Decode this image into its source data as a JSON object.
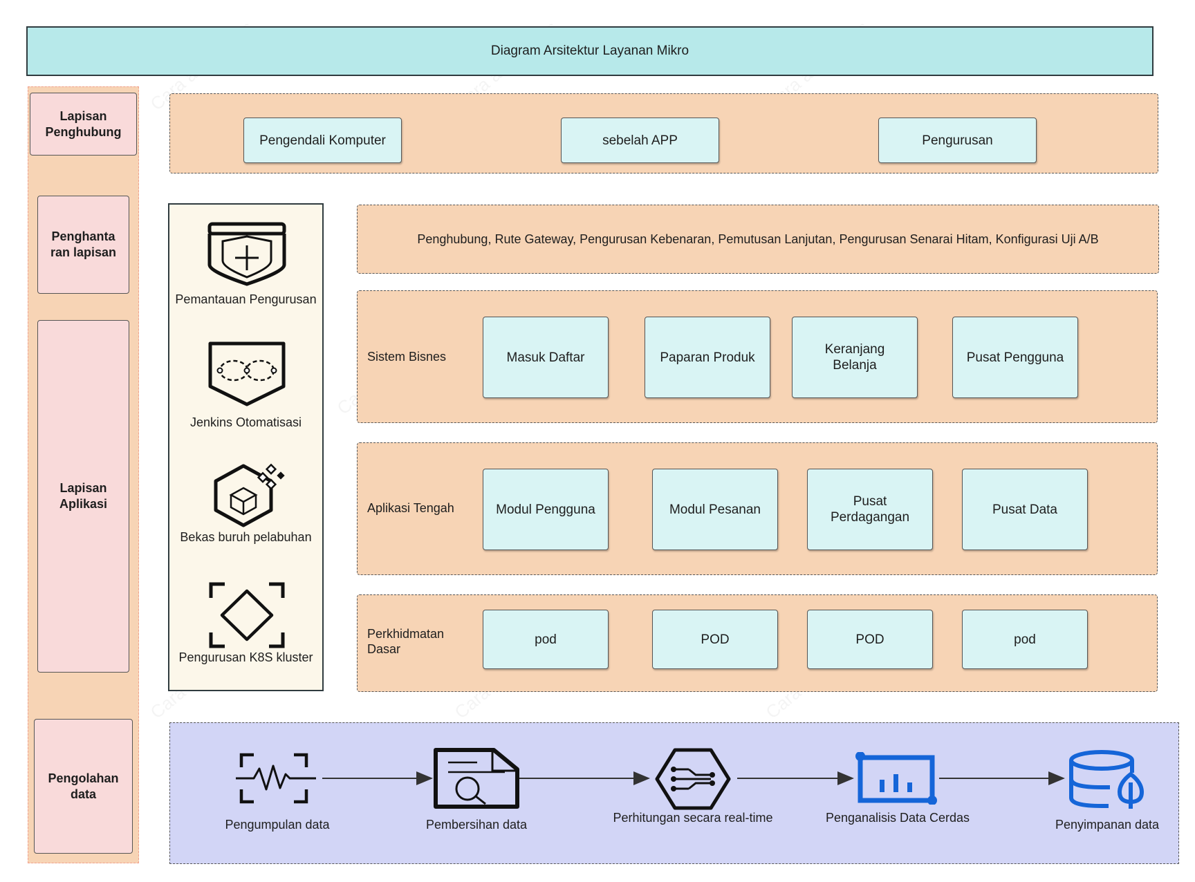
{
  "title": "Diagram Arsitektur Layanan Mikro",
  "layers": {
    "access": "Lapisan Penghubung",
    "gateway": "Penghanta ran lapisan",
    "application": "Lapisan Aplikasi",
    "data": "Pengolahan data"
  },
  "access_row": {
    "items": [
      "Pengendali Komputer",
      "sebelah APP",
      "Pengurusan"
    ]
  },
  "gateway_row": {
    "text": "Penghubung, Rute Gateway, Pengurusan Kebenaran, Pemutusan Lanjutan, Pengurusan Senarai Hitam, Konfigurasi Uji A/B"
  },
  "business_row": {
    "label": "Sistem Bisnes",
    "items": [
      "Masuk Daftar",
      "Paparan Produk",
      "Keranjang Belanja",
      "Pusat Pengguna"
    ]
  },
  "middle_row": {
    "label": "Aplikasi Tengah",
    "items": [
      "Modul Pengguna",
      "Modul Pesanan",
      "Pusat Perdagangan",
      "Pusat Data"
    ]
  },
  "base_row": {
    "label": "Perkhidmatan Dasar",
    "items": [
      "pod",
      "POD",
      "POD",
      "pod"
    ]
  },
  "ops": {
    "items": [
      {
        "label": "Pemantauan Pengurusan",
        "icon": "shield-plus-icon"
      },
      {
        "label": "Jenkins Otomatisasi",
        "icon": "infinity-badge-icon"
      },
      {
        "label": "Bekas buruh pelabuhan",
        "icon": "container-cube-icon"
      },
      {
        "label": "Pengurusan K8S kluster",
        "icon": "cluster-diamond-icon"
      }
    ]
  },
  "data_flow": {
    "steps": [
      {
        "label": "Pengumpulan data",
        "icon": "waveform-icon"
      },
      {
        "label": "Pembersihan data",
        "icon": "document-search-icon"
      },
      {
        "label": "Perhitungan secara real-time",
        "icon": "hexagon-circuit-icon"
      },
      {
        "label": "Penganalisis Data Cerdas",
        "icon": "bar-chart-icon"
      },
      {
        "label": "Penyimpanan data",
        "icon": "database-icon"
      }
    ]
  },
  "colors": {
    "title_fill": "#b7e9ea",
    "panel_fill": "#f7d4b5",
    "label_fill": "#f9dada",
    "box_fill": "#d9f4f4",
    "ops_fill": "#fcf7ea",
    "data_fill": "#d2d5f6",
    "accent_blue": "#1565d8"
  }
}
